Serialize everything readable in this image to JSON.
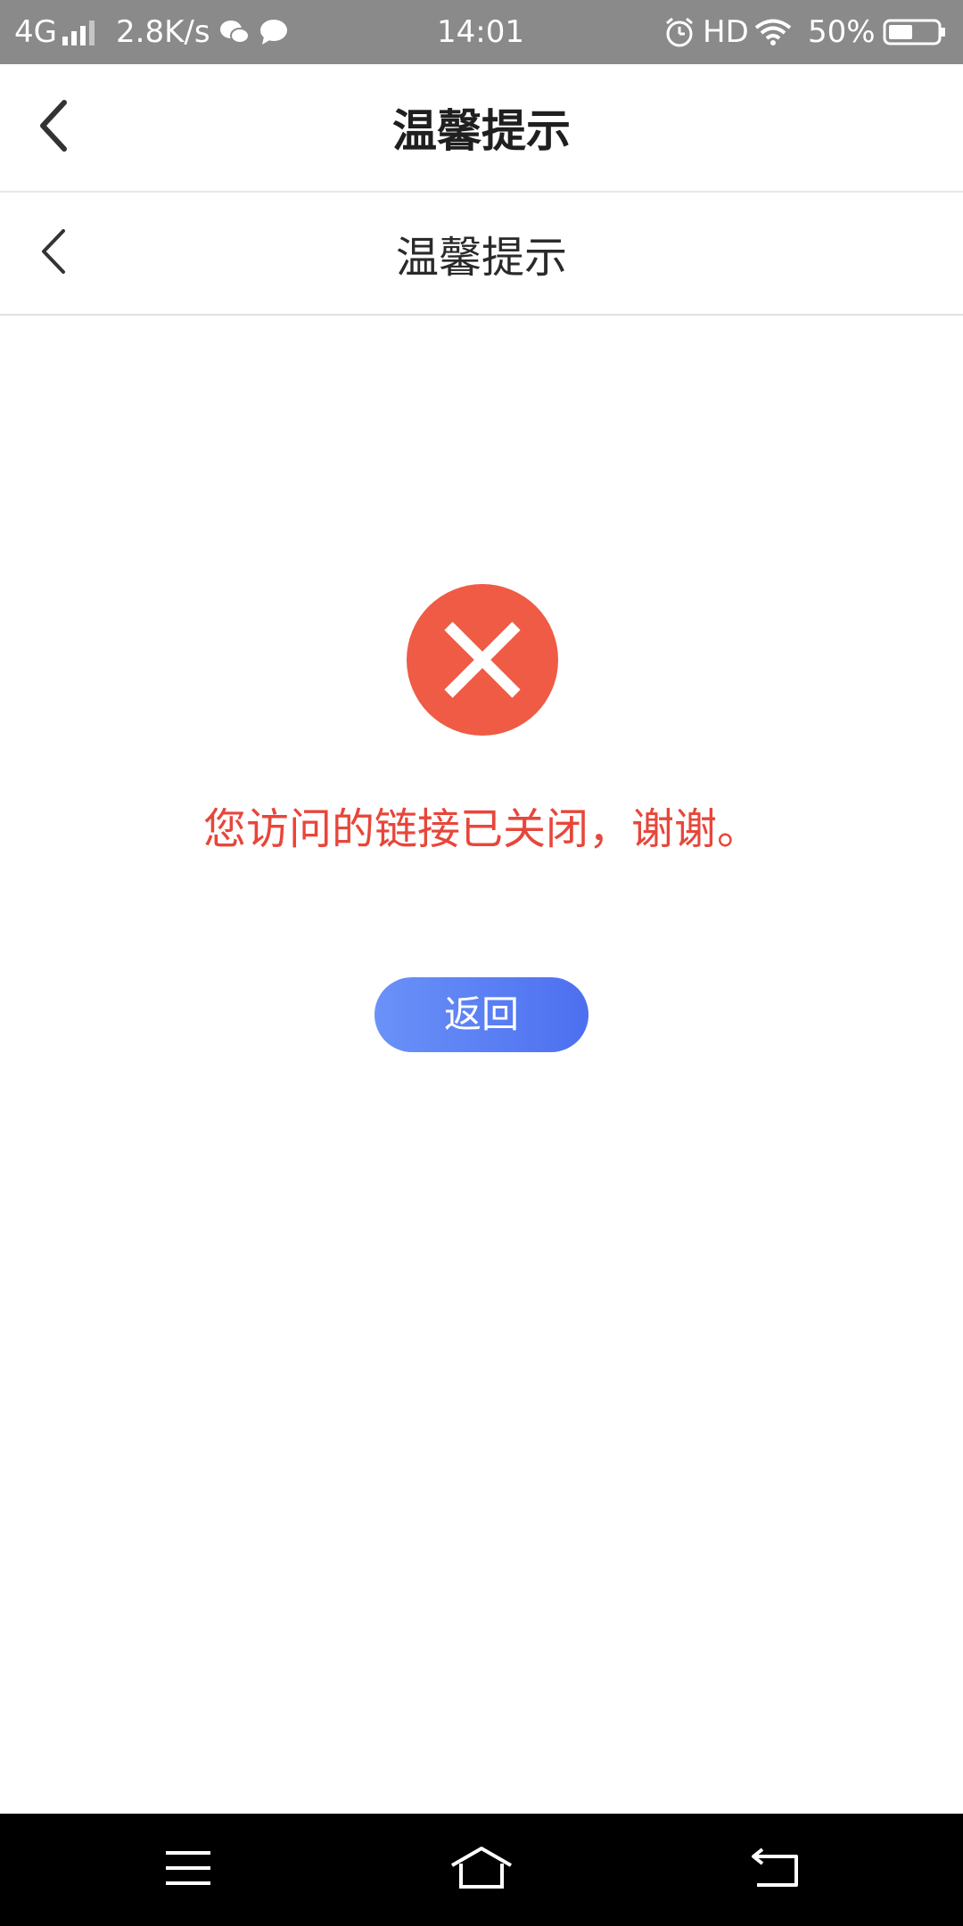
{
  "status_bar": {
    "network": "4G",
    "speed": "2.8K/s",
    "time": "14:01",
    "hd": "HD",
    "battery": "50%",
    "icons": [
      "signal-icon",
      "wechat-icon",
      "message-icon",
      "alarm-icon",
      "wifi-icon",
      "battery-icon"
    ]
  },
  "app_header": {
    "title": "温馨提示",
    "back_icon": "chevron-left-icon"
  },
  "web_header": {
    "title": "温馨提示",
    "back_icon": "chevron-left-icon"
  },
  "content": {
    "icon": "error-x-icon",
    "message": "您访问的链接已关闭，谢谢。",
    "button_label": "返回"
  },
  "colors": {
    "error": "#ef5b45",
    "message": "#e8463a",
    "button_start": "#6a92f8",
    "button_end": "#4d6ff0",
    "status_bar": "#8a8a8a"
  },
  "nav_bar": {
    "icons": [
      "menu-icon",
      "home-icon",
      "back-icon"
    ]
  }
}
